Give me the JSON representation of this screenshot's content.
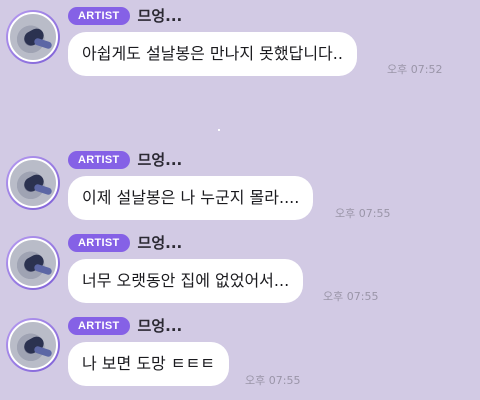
{
  "chat": {
    "messages": [
      {
        "badge": "ARTIST",
        "sender": "므엉...",
        "text": "아쉽게도 설날봉은 만나지 못했답니다..",
        "time": "오후 07:52"
      },
      {
        "badge": "ARTIST",
        "sender": "므엉...",
        "text": "이제 설날봉은 나 누군지 몰라....",
        "time": "오후 07:55"
      },
      {
        "badge": "ARTIST",
        "sender": "므엉...",
        "text": "너무 오랫동안 집에 없었어서...",
        "time": "오후 07:55"
      },
      {
        "badge": "ARTIST",
        "sender": "므엉...",
        "text": "나 보면 도망 ㅌㅌㅌ",
        "time": "오후 07:55"
      }
    ]
  },
  "colors": {
    "background": "#d2cae4",
    "badge": "#8561e6",
    "bubble": "#ffffff",
    "timestamp": "#9a95a8"
  }
}
